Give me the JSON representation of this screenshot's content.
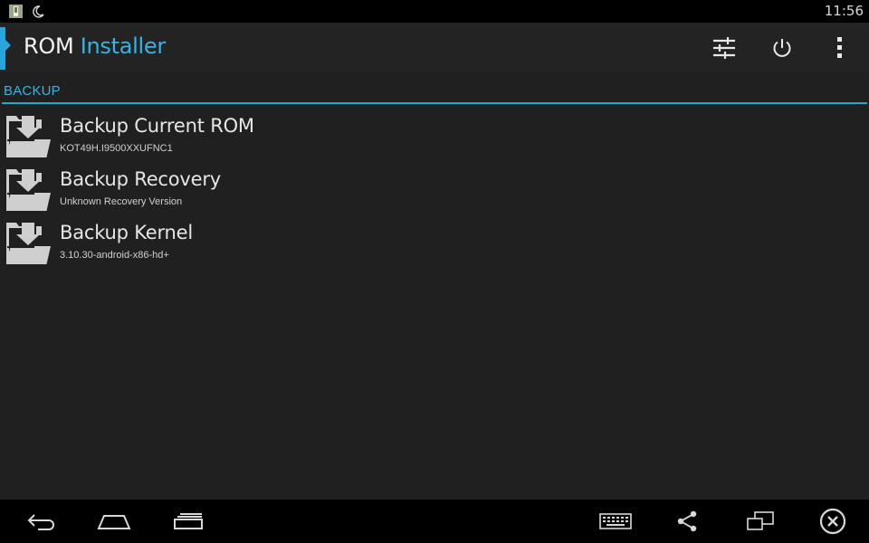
{
  "status_bar": {
    "left_icons": [
      "sdcard-notification-icon",
      "moon-icon"
    ],
    "clock": "11:56"
  },
  "action_bar": {
    "title_part1": "ROM",
    "title_part2": "Installer",
    "title_accent_color": "#33b5e5",
    "actions": [
      "settings-sliders-icon",
      "power-icon",
      "overflow-menu-icon"
    ]
  },
  "section": {
    "label": "BACKUP",
    "accent_color": "#2aa5dc"
  },
  "items": [
    {
      "title": "Backup Current ROM",
      "subtitle": "KOT49H.I9500XXUFNC1",
      "icon": "folder-download-icon"
    },
    {
      "title": "Backup Recovery",
      "subtitle": "Unknown Recovery Version",
      "icon": "folder-download-icon"
    },
    {
      "title": "Backup Kernel",
      "subtitle": "3.10.30-android-x86-hd+",
      "icon": "folder-download-icon"
    }
  ],
  "nav_bar": {
    "left": [
      "back-icon",
      "home-icon",
      "recents-icon"
    ],
    "right": [
      "keyboard-icon",
      "share-icon",
      "screen-switch-icon",
      "close-circle-icon"
    ]
  }
}
